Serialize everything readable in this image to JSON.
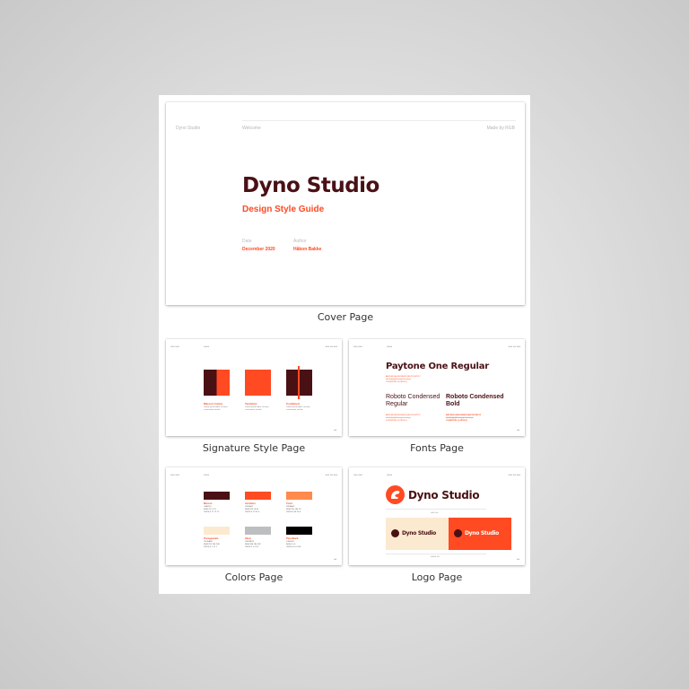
{
  "cover": {
    "header_left": "Dyno Studio",
    "header_mid": "Welcome",
    "header_right": "Made by RGB",
    "title": "Dyno Studio",
    "subtitle": "Design Style Guide",
    "date_label": "Date",
    "date_value": "December 2020",
    "author_label": "Author",
    "author_value": "Håkon Bakke",
    "caption": "Cover Page"
  },
  "signature": {
    "caption": "Signature Style Page",
    "items": [
      {
        "name": "Maroon Colour",
        "desc": "Lorem ipsum dolor sit amet, consectetur sed do"
      },
      {
        "name": "Vermilion",
        "desc": "Lorem ipsum dolor sit amet, consectetur sed do"
      },
      {
        "name": "Combined",
        "desc": "Lorem ipsum dolor sit amet, consectetur sed do"
      }
    ]
  },
  "fonts": {
    "caption": "Fonts Page",
    "primary": "Paytone One Regular",
    "secondary_regular": "Roboto Condensed Regular",
    "secondary_bold": "Roboto Condensed Bold",
    "sample_upper": "ABCDEFGHIJKLMNOPQRSTUVWXYZ",
    "sample_lower": "abcdefghijklmnopqrstuvwxyz",
    "sample_digits": "1234567890 !@#$%&*()"
  },
  "colors": {
    "caption": "Colors Page",
    "swatches": [
      {
        "name": "Maroon",
        "hex": "#4A1115",
        "rgb": "RGB 74 17 21",
        "cmyk": "CMYK 0 77 72 71"
      },
      {
        "name": "Vermilion",
        "hex": "#FF4A22",
        "rgb": "RGB 255 74 34",
        "cmyk": "CMYK 0 71 87 0"
      },
      {
        "name": "Coral",
        "hex": "#FF8A4C",
        "rgb": "RGB 255 138 76",
        "cmyk": "CMYK 0 46 70 0"
      },
      {
        "name": "Pomegranate",
        "hex": "#FCEAD0",
        "rgb": "RGB 252 234 208",
        "cmyk": "CMYK 0 7 17 1"
      },
      {
        "name": "Silver",
        "hex": "#BCBEC0",
        "rgb": "RGB 188 190 192",
        "cmyk": "CMYK 2 1 0 25"
      },
      {
        "name": "Pure Black",
        "hex": "#000000",
        "rgb": "RGB 0 0 0",
        "cmyk": "CMYK 0 0 0 100"
      }
    ]
  },
  "logo": {
    "caption": "Logo Page",
    "wordmark": "Dyno Studio"
  },
  "palette": {
    "maroon": "#4a1115",
    "orange": "#ff4a22",
    "coral": "#ff8a4c",
    "cream": "#fcead0",
    "silver": "#bcbec0",
    "black": "#000000"
  }
}
